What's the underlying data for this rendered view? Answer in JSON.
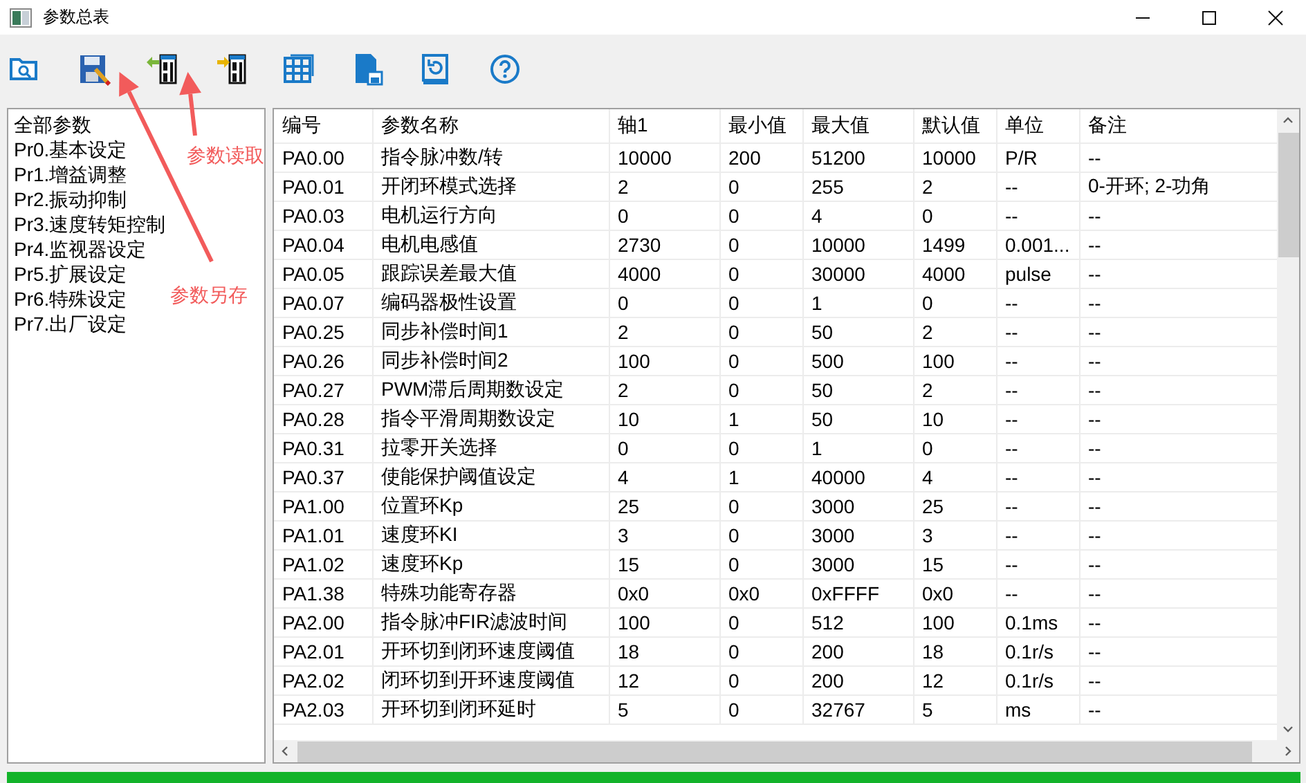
{
  "window": {
    "title": "参数总表"
  },
  "toolbar": {
    "buttons": [
      {
        "kind": "open"
      },
      {
        "kind": "save"
      },
      {
        "kind": "read"
      },
      {
        "kind": "write"
      },
      {
        "kind": "table"
      },
      {
        "kind": "export"
      },
      {
        "kind": "restore"
      },
      {
        "kind": "help"
      }
    ]
  },
  "annotations": [
    {
      "text": "参数读取"
    },
    {
      "text": "参数另存"
    }
  ],
  "sidebar": {
    "items": [
      "全部参数",
      "Pr0.基本设定",
      "Pr1.增益调整",
      "Pr2.振动抑制",
      "Pr3.速度转矩控制",
      "Pr4.监视器设定",
      "Pr5.扩展设定",
      "Pr6.特殊设定",
      "Pr7.出厂设定"
    ]
  },
  "table": {
    "columns": [
      "编号",
      "参数名称",
      "轴1",
      "最小值",
      "最大值",
      "默认值",
      "单位",
      "备注"
    ],
    "rows": [
      [
        "PA0.00",
        "指令脉冲数/转",
        "10000",
        "200",
        "51200",
        "10000",
        "P/R",
        "--"
      ],
      [
        "PA0.01",
        "开闭环模式选择",
        "2",
        "0",
        "255",
        "2",
        "--",
        "0-开环; 2-功角"
      ],
      [
        "PA0.03",
        "电机运行方向",
        "0",
        "0",
        "4",
        "0",
        "--",
        "--"
      ],
      [
        "PA0.04",
        "电机电感值",
        "2730",
        "0",
        "10000",
        "1499",
        "0.001...",
        "--"
      ],
      [
        "PA0.05",
        "跟踪误差最大值",
        "4000",
        "0",
        "30000",
        "4000",
        "pulse",
        "--"
      ],
      [
        "PA0.07",
        "编码器极性设置",
        "0",
        "0",
        "1",
        "0",
        "--",
        "--"
      ],
      [
        "PA0.25",
        "同步补偿时间1",
        "2",
        "0",
        "50",
        "2",
        "--",
        "--"
      ],
      [
        "PA0.26",
        "同步补偿时间2",
        "100",
        "0",
        "500",
        "100",
        "--",
        "--"
      ],
      [
        "PA0.27",
        "PWM滞后周期数设定",
        "2",
        "0",
        "50",
        "2",
        "--",
        "--"
      ],
      [
        "PA0.28",
        "指令平滑周期数设定",
        "10",
        "1",
        "50",
        "10",
        "--",
        "--"
      ],
      [
        "PA0.31",
        "拉零开关选择",
        "0",
        "0",
        "1",
        "0",
        "--",
        "--"
      ],
      [
        "PA0.37",
        "使能保护阈值设定",
        "4",
        "1",
        "40000",
        "4",
        "--",
        "--"
      ],
      [
        "PA1.00",
        "位置环Kp",
        "25",
        "0",
        "3000",
        "25",
        "--",
        "--"
      ],
      [
        "PA1.01",
        "速度环KI",
        "3",
        "0",
        "3000",
        "3",
        "--",
        "--"
      ],
      [
        "PA1.02",
        "速度环Kp",
        "15",
        "0",
        "3000",
        "15",
        "--",
        "--"
      ],
      [
        "PA1.38",
        "特殊功能寄存器",
        "0x0",
        "0x0",
        "0xFFFF",
        "0x0",
        "--",
        "--"
      ],
      [
        "PA2.00",
        "指令脉冲FIR滤波时间",
        "100",
        "0",
        "512",
        "100",
        "0.1ms",
        "--"
      ],
      [
        "PA2.01",
        "开环切到闭环速度阈值",
        "18",
        "0",
        "200",
        "18",
        "0.1r/s",
        "--"
      ],
      [
        "PA2.02",
        "闭环切到开环速度阈值",
        "12",
        "0",
        "200",
        "12",
        "0.1r/s",
        "--"
      ],
      [
        "PA2.03",
        "开环切到闭环延时",
        "5",
        "0",
        "32767",
        "5",
        "ms",
        "--"
      ]
    ]
  },
  "progress": {
    "level": 1
  }
}
